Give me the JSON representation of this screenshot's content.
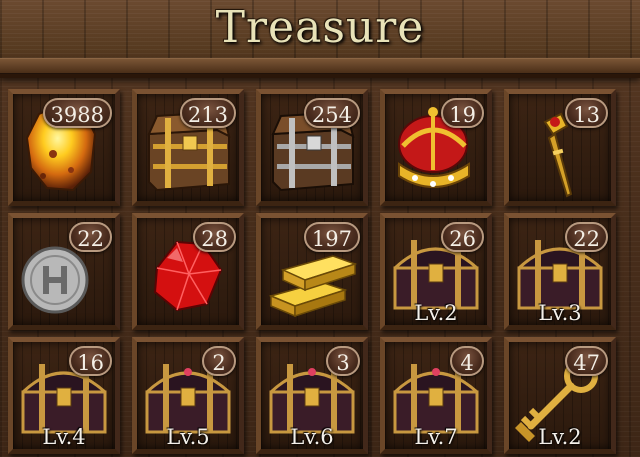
{
  "header": {
    "title": "Treasure"
  },
  "items": [
    {
      "name": "gold-ore-icon",
      "count": "3988",
      "level": ""
    },
    {
      "name": "gold-chest-icon",
      "count": "213",
      "level": ""
    },
    {
      "name": "silver-chest-icon",
      "count": "254",
      "level": ""
    },
    {
      "name": "crown-icon",
      "count": "19",
      "level": ""
    },
    {
      "name": "scepter-icon",
      "count": "13",
      "level": ""
    },
    {
      "name": "silver-coin-icon",
      "count": "22",
      "level": ""
    },
    {
      "name": "ruby-icon",
      "count": "28",
      "level": ""
    },
    {
      "name": "gold-bars-icon",
      "count": "197",
      "level": ""
    },
    {
      "name": "treasure-chest-icon",
      "count": "26",
      "level": "Lv.2"
    },
    {
      "name": "treasure-chest-icon",
      "count": "22",
      "level": "Lv.3"
    },
    {
      "name": "treasure-chest-icon",
      "count": "16",
      "level": "Lv.4"
    },
    {
      "name": "treasure-chest-icon",
      "count": "2",
      "level": "Lv.5"
    },
    {
      "name": "treasure-chest-icon",
      "count": "3",
      "level": "Lv.6"
    },
    {
      "name": "treasure-chest-icon",
      "count": "4",
      "level": "Lv.7"
    },
    {
      "name": "golden-key-icon",
      "count": "47",
      "level": "Lv.2"
    }
  ]
}
